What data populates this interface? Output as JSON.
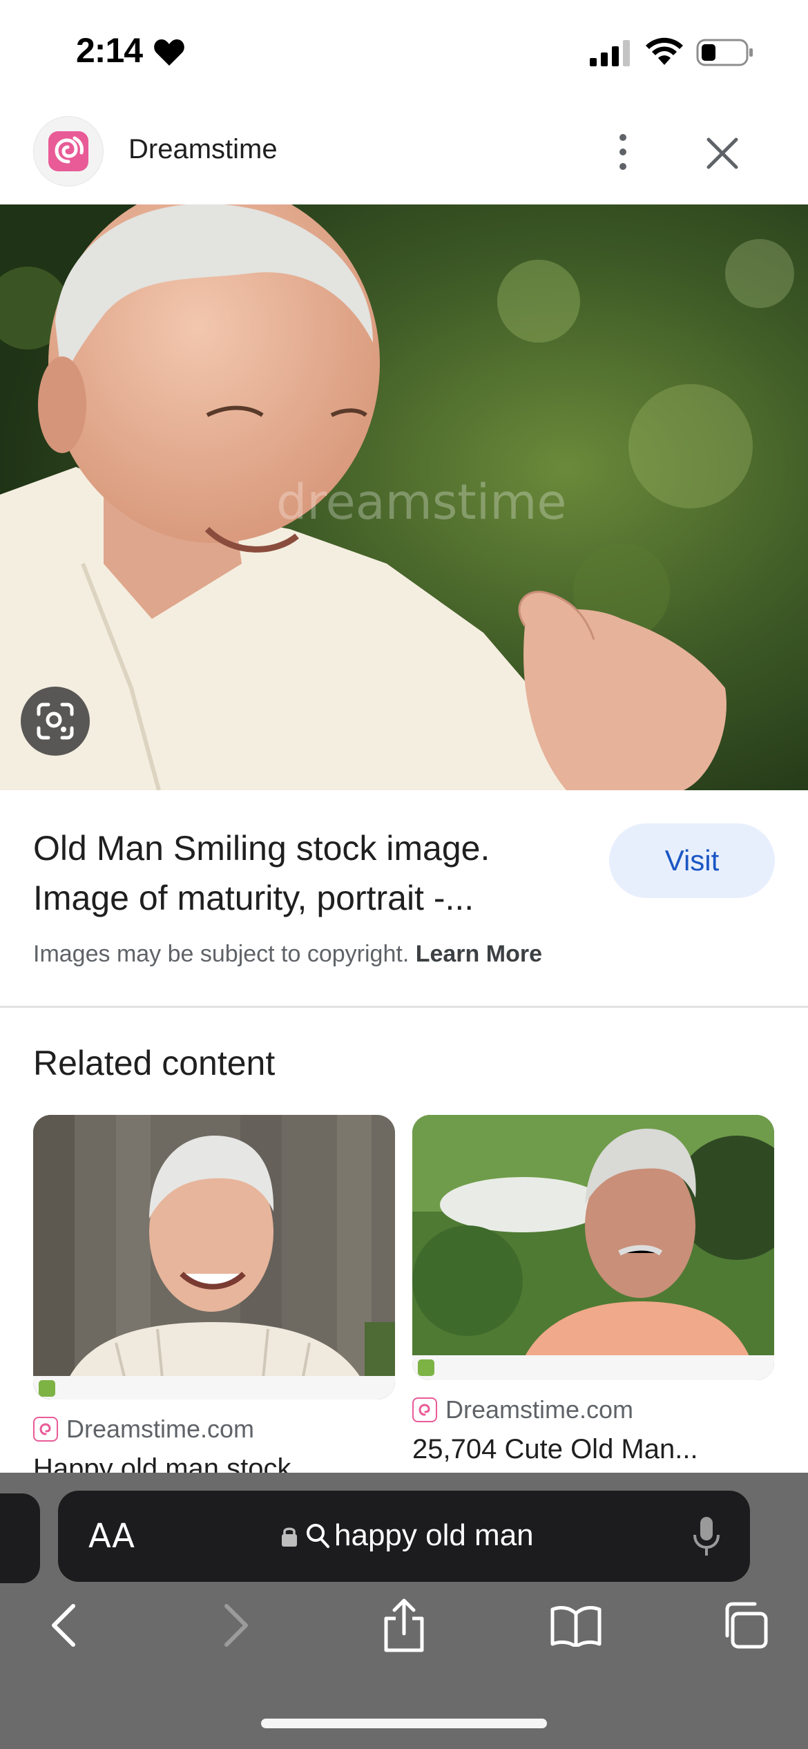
{
  "status_bar": {
    "time": "2:14"
  },
  "header": {
    "source_name": "Dreamstime"
  },
  "main": {
    "watermark": "dreamstime",
    "title": "Old Man Smiling stock image. Image of maturity, portrait -...",
    "visit_label": "Visit",
    "copyright_text": "Images may be subject to copyright.",
    "learn_more_label": "Learn More"
  },
  "related": {
    "heading": "Related content",
    "cards": [
      {
        "source": "Dreamstime.com",
        "title": "Happy old man stock"
      },
      {
        "source": "Dreamstime.com",
        "title": "25,704 Cute Old Man..."
      }
    ]
  },
  "browser": {
    "aa_label": "AA",
    "address": "happy old man"
  },
  "colors": {
    "brand_pink": "#e85b97",
    "visit_bg": "#e8effc",
    "visit_text": "#1a56c4",
    "chrome_bg": "#6b6b6b",
    "pill_bg": "#1c1c1e"
  },
  "icons": [
    "heart-icon",
    "signal-icon",
    "wifi-icon",
    "battery-icon",
    "more-icon",
    "close-icon",
    "lens-icon",
    "lock-icon",
    "search-icon",
    "mic-icon",
    "back-icon",
    "forward-icon",
    "share-icon",
    "bookmarks-icon",
    "tabs-icon"
  ]
}
